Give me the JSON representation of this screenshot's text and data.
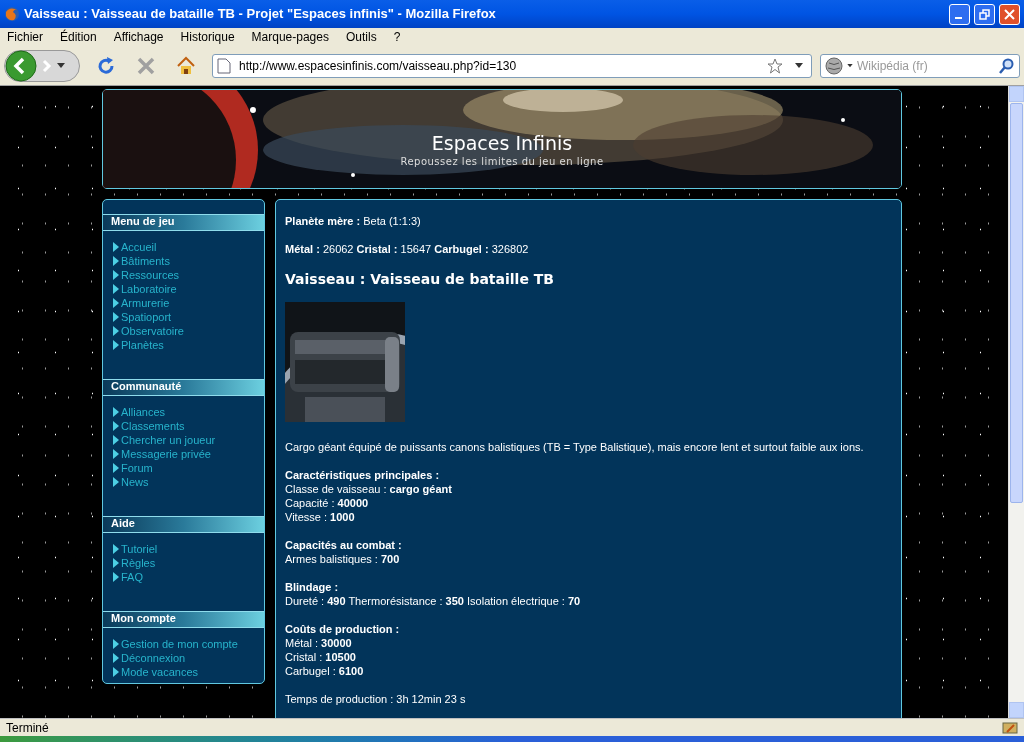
{
  "window": {
    "title": "Vaisseau : Vaisseau de bataille TB - Projet \"Espaces infinis\" - Mozilla Firefox"
  },
  "menu_bar": [
    "Fichier",
    "Édition",
    "Affichage",
    "Historique",
    "Marque-pages",
    "Outils",
    "?"
  ],
  "toolbar": {
    "url": "http://www.espacesinfinis.com/vaisseau.php?id=130",
    "search_placeholder": "Wikipédia (fr)"
  },
  "header": {
    "title": "Espaces Infinis",
    "subtitle": "Repoussez les limites du jeu en ligne"
  },
  "sidebar": [
    {
      "title": "Menu de jeu",
      "items": [
        "Accueil",
        "Bâtiments",
        "Ressources",
        "Laboratoire",
        "Armurerie",
        "Spatioport",
        "Observatoire",
        "Planètes"
      ]
    },
    {
      "title": "Communauté",
      "items": [
        "Alliances",
        "Classements",
        "Chercher un joueur",
        "Messagerie privée",
        "Forum",
        "News"
      ]
    },
    {
      "title": "Aide",
      "items": [
        "Tutoriel",
        "Règles",
        "FAQ"
      ]
    },
    {
      "title": "Mon compte",
      "items": [
        "Gestion de mon compte",
        "Déconnexion",
        "Mode vacances"
      ]
    }
  ],
  "main": {
    "planet": "**Planète mère :** Beta (1:1:3)",
    "resources": "**Métal :** 26062 **Cristal :** 15647 **Carbugel :** 326802",
    "heading": "Vaisseau : Vaisseau de bataille TB",
    "description": "Cargo géant équipé de puissants canons balistiques (TB = Type Balistique), mais encore lent et surtout faible aux ions.",
    "sections": [
      {
        "title": "Caractéristiques principales :",
        "lines": [
          "Classe de vaisseau : **cargo géant**",
          "Capacité : **40000**",
          "Vitesse : **1000**"
        ]
      },
      {
        "title": "Capacités au combat :",
        "lines": [
          "Armes balistiques : **700**"
        ]
      },
      {
        "title": "Blindage :",
        "lines": [
          "Dureté : **490** Thermorésistance : **350** Isolation électrique : **70**"
        ]
      },
      {
        "title": "Coûts de production :",
        "lines": [
          "Métal : **30000**",
          "Cristal : **10500**",
          "Carbugel : **6100**"
        ]
      }
    ],
    "production_time": "Temps de production : 3h 12min 23 s"
  },
  "status_bar": {
    "text": "Terminé"
  }
}
